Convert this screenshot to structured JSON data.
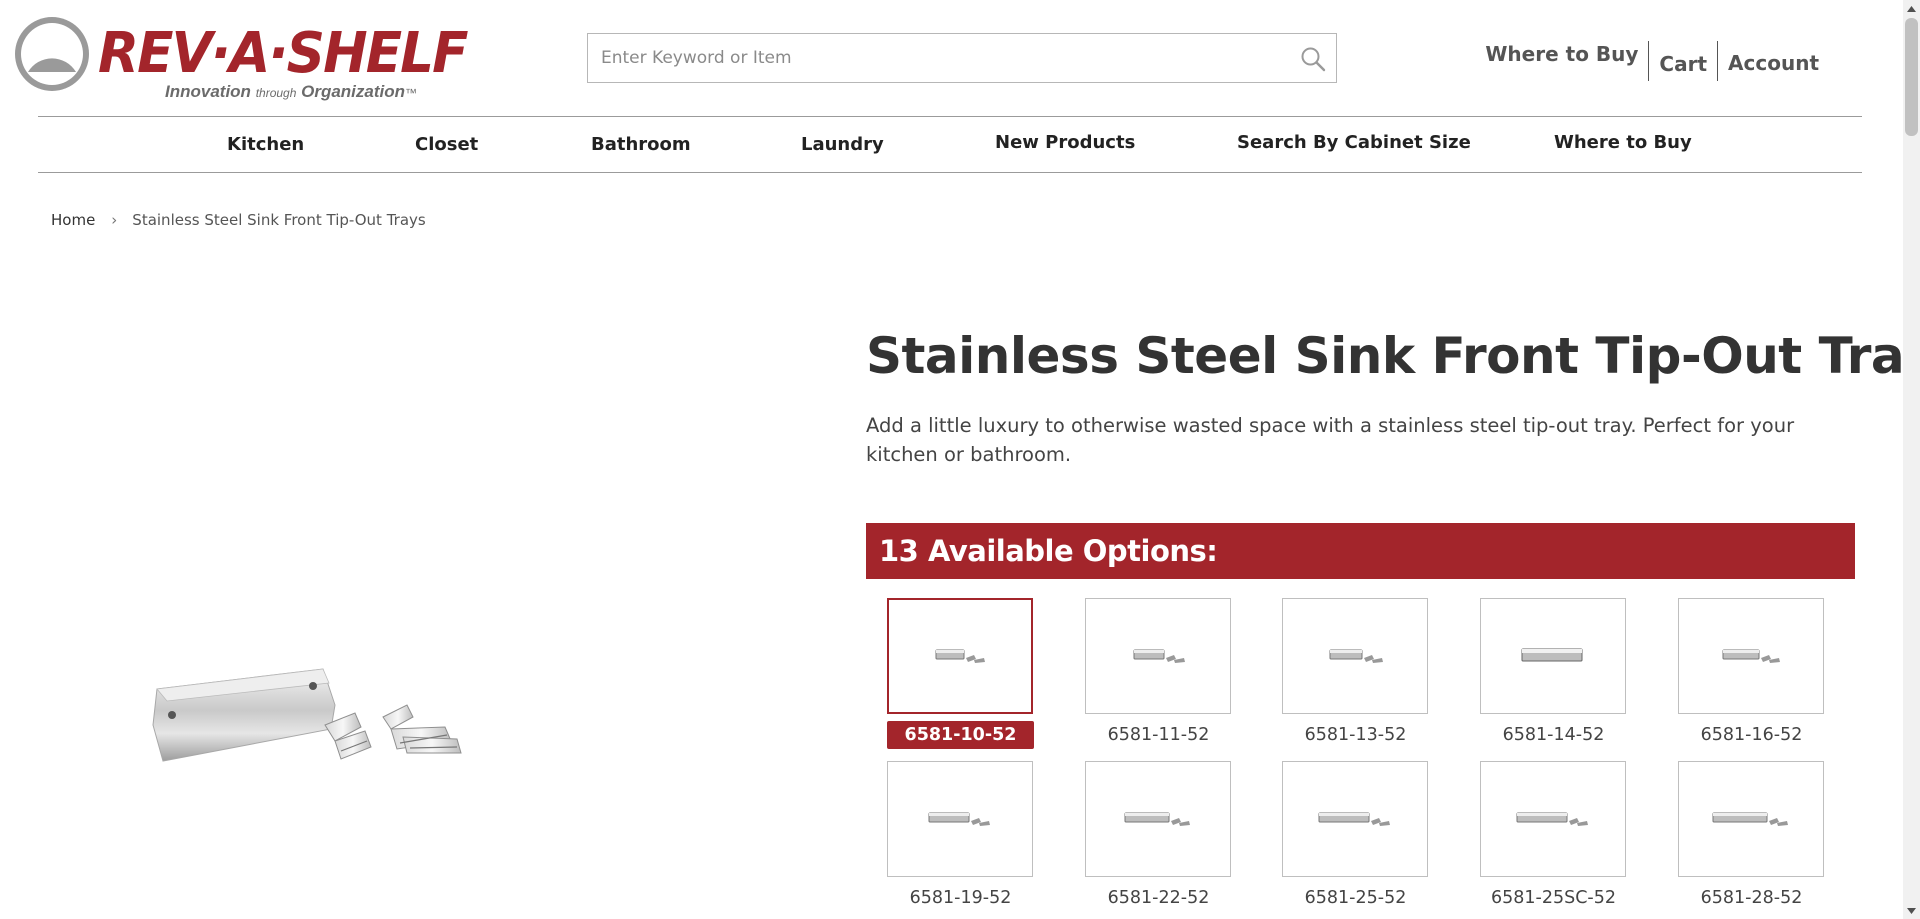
{
  "brand": {
    "name": "REV·A·SHELF",
    "tagline_part1": "Innovation",
    "tagline_part2": "through",
    "tagline_part3": "Organization",
    "tagline_mark": "™",
    "color": "#a3252b"
  },
  "search": {
    "placeholder": "Enter Keyword or Item",
    "value": "",
    "icon": "search-icon"
  },
  "header_links": {
    "where_to_buy": "Where to Buy",
    "cart": "Cart",
    "account": "Account"
  },
  "nav": {
    "items": [
      {
        "label": "Kitchen"
      },
      {
        "label": "Closet"
      },
      {
        "label": "Bathroom"
      },
      {
        "label": "Laundry"
      },
      {
        "label": "New Products"
      },
      {
        "label": "Search By Cabinet Size"
      },
      {
        "label": "Where to Buy"
      }
    ]
  },
  "breadcrumb": {
    "home": "Home",
    "separator": "›",
    "current": "Stainless Steel Sink Front Tip-Out Trays"
  },
  "product": {
    "title": "Stainless Steel Sink Front Tip-Out Trays",
    "description": "Add a little luxury to otherwise wasted space with a stainless steel tip-out tray. Perfect for your kitchen or bathroom.",
    "options_heading": "13 Available Options:",
    "selected_option": "6581-10-52",
    "options": [
      {
        "sku": "6581-10-52"
      },
      {
        "sku": "6581-11-52"
      },
      {
        "sku": "6581-13-52"
      },
      {
        "sku": "6581-14-52"
      },
      {
        "sku": "6581-16-52"
      },
      {
        "sku": "6581-19-52"
      },
      {
        "sku": "6581-22-52"
      },
      {
        "sku": "6581-25-52"
      },
      {
        "sku": "6581-25SC-52"
      },
      {
        "sku": "6581-28-52"
      }
    ]
  },
  "colors": {
    "accent": "#a3252b",
    "text": "#333333",
    "border": "#bfbfbf"
  }
}
